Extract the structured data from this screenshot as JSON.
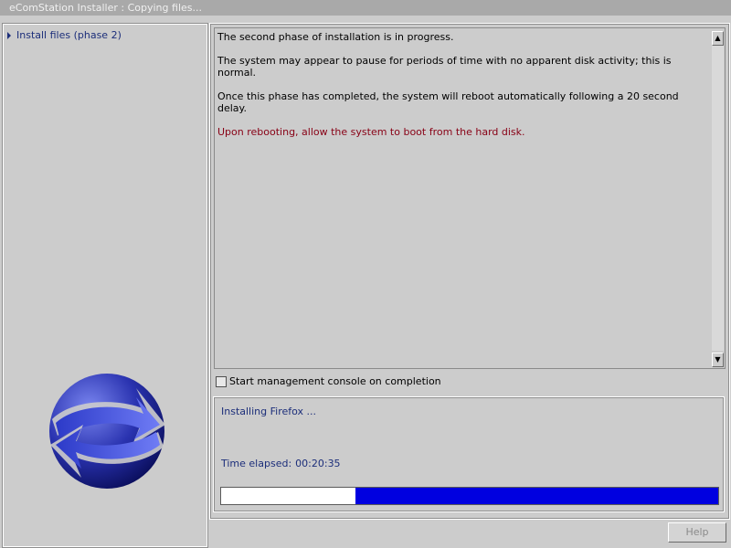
{
  "window": {
    "title": "eComStation Installer : Copying files..."
  },
  "sidebar": {
    "phase_label": "Install files (phase 2)"
  },
  "messages": {
    "line1": "The second phase of installation is in progress.",
    "line2": "The system may appear to pause for periods of time with no apparent disk activity; this is normal.",
    "line3": "Once this phase has completed, the system will reboot automatically following a 20 second delay.",
    "line4": "Upon rebooting, allow the system to boot from the hard disk."
  },
  "options": {
    "console_label": "Start management console on completion",
    "console_checked": false
  },
  "status": {
    "activity": "Installing Firefox ...",
    "elapsed_label": "Time elapsed:",
    "elapsed_value": "00:20:35",
    "progress_empty_fraction": 0.27
  },
  "buttons": {
    "help_label": "Help"
  },
  "colors": {
    "progress_fill": "#0000e0",
    "warning_text": "#880015",
    "status_text": "#1c2e7a"
  }
}
